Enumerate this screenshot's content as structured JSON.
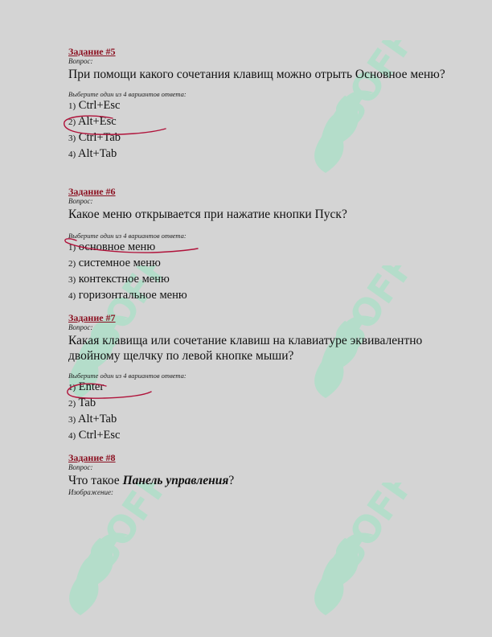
{
  "watermark": {
    "text": "SOFF",
    "color": "#9be5c2"
  },
  "tasks": [
    {
      "title": "Задание #5",
      "question_label": "Вопрос:",
      "question": "При помощи какого сочетания клавищ можно отрыть Основное меню?",
      "answers_label": "Выберите один из 4 вариантов ответа:",
      "answers": [
        {
          "num": "1)",
          "text": "Ctrl+Esc"
        },
        {
          "num": "2)",
          "text": "Alt+Esc"
        },
        {
          "num": "3)",
          "text": "Ctrl+Tab"
        },
        {
          "num": "4)",
          "text": "Alt+Tab"
        }
      ]
    },
    {
      "title": "Задание #6",
      "question_label": "Вопрос:",
      "question": "Какое меню открывается при нажатие кнопки Пуск?",
      "answers_label": "Выберите один из 4 вариантов ответа:",
      "answers": [
        {
          "num": "1)",
          "text": "основное меню"
        },
        {
          "num": "2)",
          "text": "системное меню"
        },
        {
          "num": "3)",
          "text": "контекстное меню"
        },
        {
          "num": "4)",
          "text": "горизонтальное меню"
        }
      ]
    },
    {
      "title": "Задание #7",
      "question_label": "Вопрос:",
      "question": "Какая клавища или сочетание клавиш на клавиатуре эквивалентно двойному щелчку по левой кнопке мыши?",
      "answers_label": "Выберите один из 4 вариантов ответа:",
      "answers": [
        {
          "num": "1)",
          "text": "Enter"
        },
        {
          "num": "2)",
          "text": "Tab"
        },
        {
          "num": "3)",
          "text": "Alt+Tab"
        },
        {
          "num": "4)",
          "text": "Ctrl+Esc"
        }
      ]
    },
    {
      "title": "Задание #8",
      "question_label": "Вопрос:",
      "question_prefix": "Что такое ",
      "question_emph": "Панель управления",
      "question_suffix": "?",
      "image_label": "Изображение:"
    }
  ],
  "scribble_color": "#b0123a"
}
